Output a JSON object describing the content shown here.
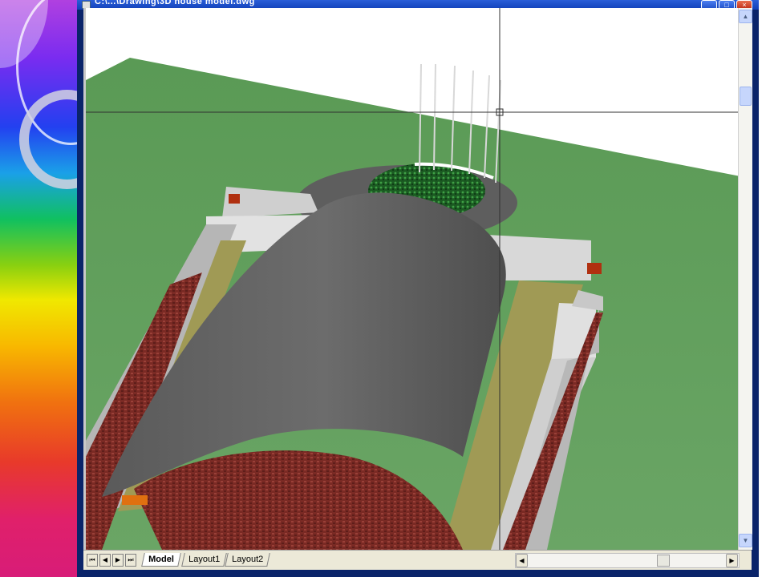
{
  "window": {
    "title": "C:\\...\\Drawing\\3D house model.dwg"
  },
  "viewport": {
    "description_icon": "autocad-3d-model-view",
    "colors": {
      "ground": "#5f9a5a",
      "roof": "#646464",
      "walls": "#d4d4d4",
      "brick": "#7a2a24",
      "path": "#a09a55",
      "plant": "#1e6e2a",
      "crosshair": "#303030"
    }
  },
  "tabs": {
    "nav_first": "⏮",
    "nav_prev": "◀",
    "nav_next": "▶",
    "nav_last": "⏭",
    "items": [
      {
        "label": "Model",
        "active": true
      },
      {
        "label": "Layout1",
        "active": false
      },
      {
        "label": "Layout2",
        "active": false
      }
    ]
  },
  "scrollbars": {
    "up": "▲",
    "down": "▼",
    "left": "◀",
    "right": "▶"
  },
  "window_buttons": {
    "minimize": "_",
    "maximize": "□",
    "close": "×"
  }
}
